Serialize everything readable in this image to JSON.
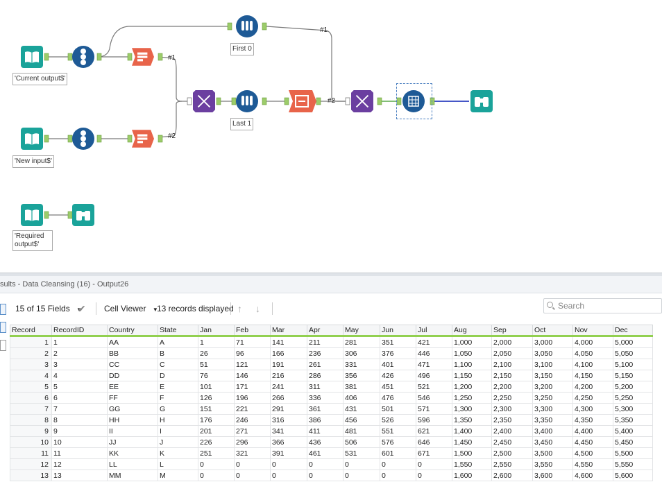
{
  "canvas": {
    "labels": {
      "current_output": "'Current output$'",
      "new_input": "'New input$'",
      "required_output": "'Required output$'",
      "first": "First 0",
      "last": "Last 1"
    },
    "anchors": {
      "a1": "#1",
      "a2": "#2",
      "a3": "#1",
      "a4": "#2"
    }
  },
  "results": {
    "title": "sults - Data Cleansing (16) - Output26",
    "fields_label": "15 of 15 Fields",
    "cell_viewer_label": "Cell Viewer",
    "records_label": "13 records displayed",
    "search_placeholder": "Search"
  },
  "table": {
    "columns": [
      "Record",
      "RecordID",
      "Country",
      "State",
      "Jan",
      "Feb",
      "Mar",
      "Apr",
      "May",
      "Jun",
      "Jul",
      "Aug",
      "Sep",
      "Oct",
      "Nov",
      "Dec"
    ],
    "rows": [
      [
        "1",
        "1",
        "AA",
        "A",
        "1",
        "71",
        "141",
        "211",
        "281",
        "351",
        "421",
        "1,000",
        "2,000",
        "3,000",
        "4,000",
        "5,000"
      ],
      [
        "2",
        "2",
        "BB",
        "B",
        "26",
        "96",
        "166",
        "236",
        "306",
        "376",
        "446",
        "1,050",
        "2,050",
        "3,050",
        "4,050",
        "5,050"
      ],
      [
        "3",
        "3",
        "CC",
        "C",
        "51",
        "121",
        "191",
        "261",
        "331",
        "401",
        "471",
        "1,100",
        "2,100",
        "3,100",
        "4,100",
        "5,100"
      ],
      [
        "4",
        "4",
        "DD",
        "D",
        "76",
        "146",
        "216",
        "286",
        "356",
        "426",
        "496",
        "1,150",
        "2,150",
        "3,150",
        "4,150",
        "5,150"
      ],
      [
        "5",
        "5",
        "EE",
        "E",
        "101",
        "171",
        "241",
        "311",
        "381",
        "451",
        "521",
        "1,200",
        "2,200",
        "3,200",
        "4,200",
        "5,200"
      ],
      [
        "6",
        "6",
        "FF",
        "F",
        "126",
        "196",
        "266",
        "336",
        "406",
        "476",
        "546",
        "1,250",
        "2,250",
        "3,250",
        "4,250",
        "5,250"
      ],
      [
        "7",
        "7",
        "GG",
        "G",
        "151",
        "221",
        "291",
        "361",
        "431",
        "501",
        "571",
        "1,300",
        "2,300",
        "3,300",
        "4,300",
        "5,300"
      ],
      [
        "8",
        "8",
        "HH",
        "H",
        "176",
        "246",
        "316",
        "386",
        "456",
        "526",
        "596",
        "1,350",
        "2,350",
        "3,350",
        "4,350",
        "5,350"
      ],
      [
        "9",
        "9",
        "II",
        "I",
        "201",
        "271",
        "341",
        "411",
        "481",
        "551",
        "621",
        "1,400",
        "2,400",
        "3,400",
        "4,400",
        "5,400"
      ],
      [
        "10",
        "10",
        "JJ",
        "J",
        "226",
        "296",
        "366",
        "436",
        "506",
        "576",
        "646",
        "1,450",
        "2,450",
        "3,450",
        "4,450",
        "5,450"
      ],
      [
        "11",
        "11",
        "KK",
        "K",
        "251",
        "321",
        "391",
        "461",
        "531",
        "601",
        "671",
        "1,500",
        "2,500",
        "3,500",
        "4,500",
        "5,500"
      ],
      [
        "12",
        "12",
        "LL",
        "L",
        "0",
        "0",
        "0",
        "0",
        "0",
        "0",
        "0",
        "1,550",
        "2,550",
        "3,550",
        "4,550",
        "5,550"
      ],
      [
        "13",
        "13",
        "MM",
        "M",
        "0",
        "0",
        "0",
        "0",
        "0",
        "0",
        "0",
        "1,600",
        "2,600",
        "3,600",
        "4,600",
        "5,600"
      ]
    ]
  }
}
